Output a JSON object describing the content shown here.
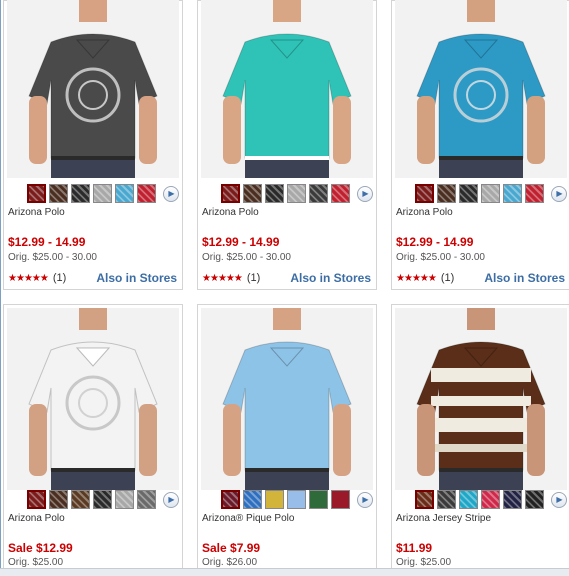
{
  "products": [
    {
      "name": "Arizona Polo",
      "price": "$12.99 - 14.99",
      "orig": "Orig. $25.00 - 30.00",
      "rating_count": "(1)",
      "stars": 5,
      "stores_link": "Also in Stores",
      "shirt": "#4a4a4a",
      "skin": "#d6a283",
      "bg": "#f2f2f2",
      "swatches": [
        "#7a1c1c",
        "#4a2e20",
        "#2a2a2a",
        "#a8a8a8",
        "#4aa7d0",
        "#c02030"
      ]
    },
    {
      "name": "Arizona Polo",
      "price": "$12.99 - 14.99",
      "orig": "Orig. $25.00 - 30.00",
      "rating_count": "(1)",
      "stars": 5,
      "stores_link": "Also in Stores",
      "shirt": "#2fc3b7",
      "skin": "#d8a585",
      "bg": "#f2f2f2",
      "swatches": [
        "#7a1c1c",
        "#4a2e20",
        "#2a2a2a",
        "#a8a8a8",
        "#3a3a3a",
        "#c02030"
      ]
    },
    {
      "name": "Arizona Polo",
      "price": "$12.99 - 14.99",
      "orig": "Orig. $25.00 - 30.00",
      "rating_count": "(1)",
      "stars": 5,
      "stores_link": "Also in Stores",
      "shirt": "#2d9ac6",
      "skin": "#d3a080",
      "bg": "#f2f2f2",
      "swatches": [
        "#7a1c1c",
        "#4a2e20",
        "#2a2a2a",
        "#a8a8a8",
        "#4aa7d0",
        "#c02030"
      ]
    },
    {
      "name": "Arizona Polo",
      "price": "Sale $12.99",
      "orig": "Orig. $25.00",
      "stars": 0,
      "shirt": "#f3f3f3",
      "skin": "#d2a082",
      "bg": "#f2f2f2",
      "swatches": [
        "#7a1c1c",
        "#4a2e20",
        "#5a3a22",
        "#2a2a2a",
        "#a8a8a8",
        "#6a6a6a"
      ]
    },
    {
      "name": "Arizona® Pique Polo",
      "price": "Sale $7.99",
      "orig": "Orig. $26.00",
      "stars": 0,
      "shirt": "#8ec3e8",
      "skin": "#d5a384",
      "bg": "#f2f2f2",
      "swatches": [
        "#6a1a2a",
        "#2f6fbf",
        "#d2b43a",
        "#98bde8",
        "#2f6a3a",
        "#9a1a2a"
      ]
    },
    {
      "name": "Arizona Jersey Stripe",
      "price": "$11.99",
      "orig": "Orig. $25.00",
      "stars": 0,
      "shirt": "#5a2e18",
      "skin": "#c99578",
      "bg": "#f2f2f2",
      "swatches": [
        "#6a2e18",
        "#3a3a3a",
        "#20a7c8",
        "#d0284a",
        "#222244",
        "#222222"
      ]
    }
  ],
  "ui": {
    "more_colors_icon": "chevron-right-icon",
    "star_icon": "star-icon"
  }
}
